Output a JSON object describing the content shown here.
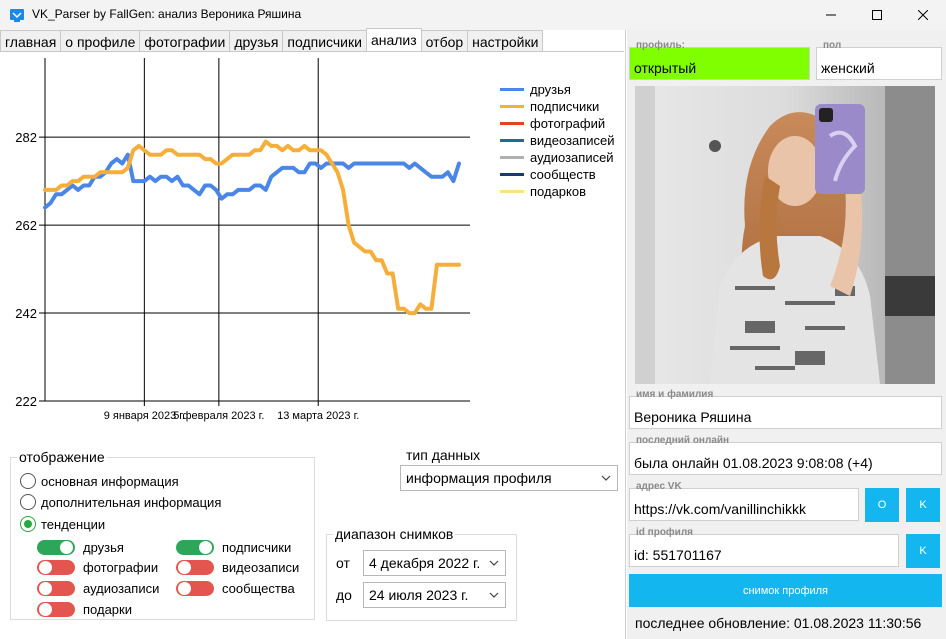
{
  "window": {
    "title": "VK_Parser by FallGen: анализ Вероника Ряшина"
  },
  "tabs": [
    {
      "label": "главная",
      "active": false
    },
    {
      "label": "о профиле",
      "active": false
    },
    {
      "label": "фотографии",
      "active": false
    },
    {
      "label": "друзья",
      "active": false
    },
    {
      "label": "подписчики",
      "active": false
    },
    {
      "label": "анализ",
      "active": true
    },
    {
      "label": "отбор",
      "active": false
    },
    {
      "label": "настройки",
      "active": false
    }
  ],
  "chart_data": {
    "type": "line",
    "x": [
      "2022-12-04",
      "2022-12-06",
      "2022-12-08",
      "2022-12-10",
      "2022-12-12",
      "2022-12-14",
      "2022-12-16",
      "2022-12-18",
      "2022-12-20",
      "2022-12-22",
      "2022-12-24",
      "2022-12-26",
      "2022-12-28",
      "2022-12-30",
      "2023-01-01",
      "2023-01-03",
      "2023-01-05",
      "2023-01-07",
      "2023-01-09",
      "2023-01-11",
      "2023-01-13",
      "2023-01-15",
      "2023-01-17",
      "2023-01-19",
      "2023-01-21",
      "2023-01-23",
      "2023-01-25",
      "2023-01-27",
      "2023-01-29",
      "2023-01-31",
      "2023-02-02",
      "2023-02-04",
      "2023-02-06",
      "2023-02-08",
      "2023-02-10",
      "2023-02-12",
      "2023-02-14",
      "2023-02-16",
      "2023-02-18",
      "2023-02-20",
      "2023-02-22",
      "2023-02-24",
      "2023-02-26",
      "2023-02-28",
      "2023-03-02",
      "2023-03-04",
      "2023-03-06",
      "2023-03-08",
      "2023-03-10",
      "2023-03-12",
      "2023-03-14",
      "2023-03-16",
      "2023-03-18",
      "2023-03-20",
      "2023-03-22",
      "2023-03-24",
      "2023-03-26",
      "2023-03-28",
      "2023-03-30",
      "2023-04-01",
      "2023-04-03",
      "2023-04-05",
      "2023-04-07",
      "2023-04-09",
      "2023-04-11",
      "2023-04-13",
      "2023-04-15",
      "2023-04-17",
      "2023-04-19",
      "2023-04-21",
      "2023-04-23",
      "2023-04-25",
      "2023-04-27",
      "2023-04-29",
      "2023-05-01",
      "2023-05-03"
    ],
    "x_ticks": [
      "9 января 2023 г.",
      "5 февраля 2023 г.",
      "13 марта 2023 г."
    ],
    "x_tick_dates": [
      "2023-01-09",
      "2023-02-05",
      "2023-03-13"
    ],
    "ylim": [
      222,
      300
    ],
    "y_ticks": [
      222,
      242,
      262,
      282
    ],
    "grid": true,
    "legend_position": "right",
    "series": [
      {
        "name": "друзья",
        "color": "#4a86e8",
        "values": [
          266,
          267,
          269,
          269,
          270,
          271,
          270,
          271,
          271,
          273,
          273,
          274,
          276,
          277,
          276,
          278,
          272,
          272,
          272,
          273,
          272,
          273,
          273,
          272,
          273,
          271,
          271,
          270,
          269,
          271,
          271,
          270,
          268,
          269,
          269,
          270,
          270,
          270,
          271,
          271,
          270,
          273,
          274,
          275,
          275,
          275,
          274,
          274,
          276,
          276,
          275,
          276,
          276,
          276,
          276,
          275,
          276,
          276,
          276,
          276,
          276,
          276,
          276,
          276,
          276,
          276,
          275,
          276,
          275,
          274,
          273,
          273,
          273,
          274,
          272,
          276
        ]
      },
      {
        "name": "подписчики",
        "color": "#f6ae3a",
        "values": [
          270,
          270,
          270,
          271,
          271,
          272,
          272,
          273,
          273,
          273,
          274,
          274,
          274,
          274,
          274,
          275,
          279,
          280,
          279,
          278,
          278,
          278,
          279,
          279,
          278,
          278,
          278,
          278,
          278,
          277,
          277,
          276,
          276,
          277,
          278,
          278,
          278,
          278,
          279,
          279,
          281,
          280,
          280,
          279,
          280,
          279,
          279,
          280,
          279,
          279,
          279,
          278,
          276,
          274,
          270,
          262,
          258,
          257,
          256,
          256,
          254,
          254,
          251,
          251,
          243,
          243,
          242,
          242,
          244,
          243,
          243,
          253,
          253,
          253,
          253,
          253
        ]
      },
      {
        "name": "фотографий",
        "color": "#e0451f",
        "values": []
      },
      {
        "name": "видеозаписей",
        "color": "#1c6d94",
        "values": []
      },
      {
        "name": "аудиозаписей",
        "color": "#b0b0b0",
        "values": []
      },
      {
        "name": "сообществ",
        "color": "#173b6c",
        "values": []
      },
      {
        "name": "подарков",
        "color": "#ffe08a",
        "values": []
      }
    ]
  },
  "display_group": {
    "title": "отображение",
    "radios": [
      {
        "label": "основная информация",
        "checked": false
      },
      {
        "label": "дополнительная информация",
        "checked": false
      },
      {
        "label": "тенденции",
        "checked": true
      }
    ],
    "toggles": [
      {
        "label": "друзья",
        "on": true
      },
      {
        "label": "подписчики",
        "on": true
      },
      {
        "label": "фотографии",
        "on": false
      },
      {
        "label": "видеозаписи",
        "on": false
      },
      {
        "label": "аудиозаписи",
        "on": false
      },
      {
        "label": "сообщества",
        "on": false
      },
      {
        "label": "подарки",
        "on": false
      }
    ]
  },
  "data_type": {
    "label": "тип данных",
    "selected": "информация профиля"
  },
  "snapshot_range": {
    "title": "диапазон снимков",
    "from_label": "от",
    "from_value": "4 декабря 2022 г.",
    "to_label": "до",
    "to_value": "24 июля 2023 г."
  },
  "profile": {
    "profile_caption": "профиль:",
    "profile_value": "открытый",
    "gender_caption": "пол",
    "gender_value": "женский",
    "name_caption": "имя и фамилия",
    "name_value": "Вероника Ряшина",
    "last_online_caption": "последний онлайн",
    "last_online_value": "была онлайн 01.08.2023 9:08:08 (+4)",
    "vk_address_caption": "адрес VK",
    "vk_address_value": "https://vk.com/vanillinchikkk",
    "address_btn_o": "O",
    "address_btn_k": "K",
    "id_caption": "id профиля",
    "id_value": "id: 551701167",
    "id_btn_k": "K",
    "snapshot_button": "снимок профиля",
    "last_update": "последнее обновление: 01.08.2023 11:30:56"
  },
  "colors": {
    "accent_button": "#14b6f0",
    "profile_open": "#7fff00",
    "toggle_on": "#2ea65a",
    "toggle_off": "#e5554f"
  }
}
